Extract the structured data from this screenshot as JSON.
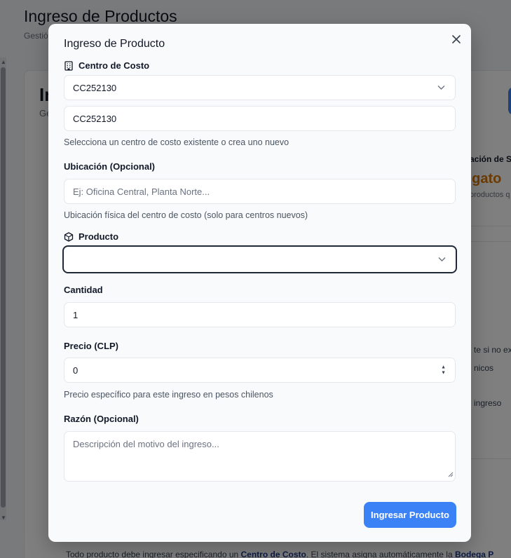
{
  "background": {
    "page_title": "Ingreso de Productos",
    "page_subtitle": "Gestió",
    "card_title": "In",
    "card_subtitle": "Ge",
    "right_heading": "ación de S",
    "right_emphasis": "ligato",
    "right_note": "productos q",
    "right_line1": "te si no ex",
    "right_line2": "nicos",
    "right_line3": "ingreso",
    "bottom_text_start": "Todo producto debe ingresar especificando un ",
    "bottom_bold_1": "Centro de Costo",
    "bottom_text_mid": ". El sistema asigna automáticamente la ",
    "bottom_bold_2": "Bodega P"
  },
  "modal": {
    "title": "Ingreso de Producto",
    "close_label": "×",
    "cost_center": {
      "label": "Centro de Costo",
      "icon": "building-icon",
      "selected": "CC252130",
      "input_value": "CC252130",
      "hint": "Selecciona un centro de costo existente o crea uno nuevo"
    },
    "location": {
      "label": "Ubicación (Opcional)",
      "placeholder": "Ej: Oficina Central, Planta Norte...",
      "hint": "Ubicación física del centro de costo (solo para centros nuevos)"
    },
    "product": {
      "label": "Producto",
      "icon": "package-icon",
      "selected": ""
    },
    "quantity": {
      "label": "Cantidad",
      "value": "1"
    },
    "price": {
      "label": "Precio (CLP)",
      "value": "0",
      "hint": "Precio específico para este ingreso en pesos chilenos"
    },
    "reason": {
      "label": "Razón (Opcional)",
      "placeholder": "Descripción del motivo del ingreso..."
    },
    "submit_label": "Ingresar Producto"
  },
  "colors": {
    "primary": "#3b82f6",
    "overlay": "rgba(0,0,0,0.5)",
    "warning_text": "#d97706"
  }
}
